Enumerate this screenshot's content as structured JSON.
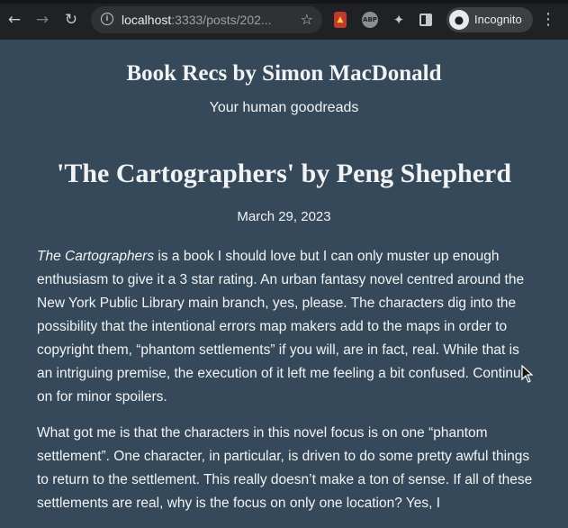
{
  "browser": {
    "url_host": "localhost",
    "url_rest": ":3333/posts/202...",
    "profile_label": "Incognito",
    "icons": [
      "back-icon",
      "forward-icon",
      "reload-icon",
      "info-icon",
      "star-icon",
      "extension-icon",
      "adblock-icon",
      "puzzle-icon",
      "sidepanel-icon",
      "incognito-icon",
      "more-menu-icon"
    ],
    "ext2_text": "ABP"
  },
  "site": {
    "title": "Book Recs by Simon MacDonald",
    "subtitle": "Your human goodreads"
  },
  "post": {
    "title": "'The Cartographers' by Peng Shepherd",
    "date": "March 29, 2023",
    "p1_em": "The Cartographers",
    "p1_rest": " is a book I should love but I can only muster up enough enthusiasm to give it a 3 star rating. An urban fantasy novel centred around the New York Public Library main branch, yes, please. The characters dig into the possibility that the intentional errors map makers add to the maps in order to copyright them, “phantom settlements” if you will, are in fact, real. While that is an intriguing premise, the execution of it left me feeling a bit confused. Continue on for minor spoilers.",
    "p2": "What got me is that the characters in this novel focus is on one “phantom settlement”. One character, in particular, is driven to do some pretty awful things to return to the settlement. This really doesn’t make a ton of sense. If all of these settlements are real, why is the focus on only one location? Yes, I"
  }
}
